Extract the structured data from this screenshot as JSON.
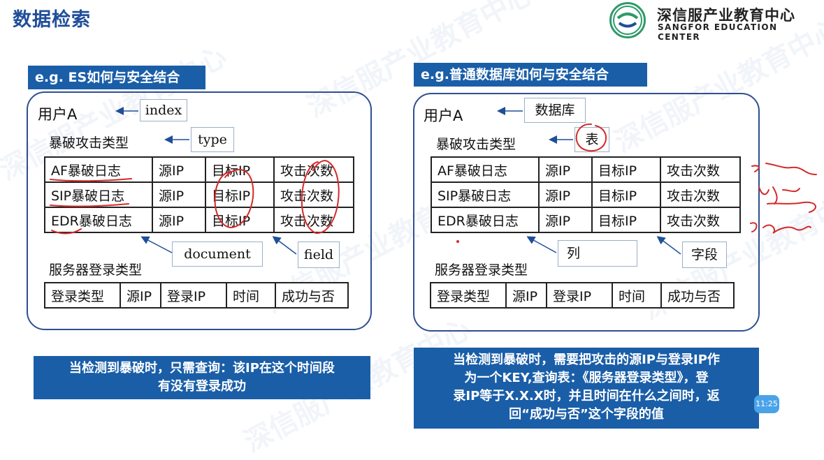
{
  "title": "数据检索",
  "logo": {
    "cn": "深信服产业教育中心",
    "en": "SANGFOR EDUCATION CENTER"
  },
  "watermark": "深信服产业教育中心",
  "left": {
    "banner": "e.g. ES如何与安全结合",
    "user": "用户A",
    "type_label": "暴破攻击类型",
    "tags": {
      "index": "index",
      "type": "type",
      "document": "document",
      "field": "field"
    },
    "table1": [
      [
        "AF暴破日志",
        "源IP",
        "目标IP",
        "攻击次数"
      ],
      [
        "SIP暴破日志",
        "源IP",
        "目标IP",
        "攻击次数"
      ],
      [
        "EDR暴破日志",
        "源IP",
        "目标IP",
        "攻击次数"
      ]
    ],
    "server_label": "服务器登录类型",
    "table2": [
      "登录类型",
      "源IP",
      "登录IP",
      "时间",
      "成功与否"
    ],
    "note": [
      "当检测到暴破时，只需查询：该IP在这个时间段",
      "有没有登录成功"
    ]
  },
  "right": {
    "banner": "e.g.普通数据库如何与安全结合",
    "user": "用户A",
    "type_label": "暴破攻击类型",
    "tags": {
      "db": "数据库",
      "table": "表",
      "column": "列",
      "field": "字段"
    },
    "table1": [
      [
        "AF暴破日志",
        "源IP",
        "目标IP",
        "攻击次数"
      ],
      [
        "SIP暴破日志",
        "源IP",
        "目标IP",
        "攻击次数"
      ],
      [
        "EDR暴破日志",
        "源IP",
        "目标IP",
        "攻击次数"
      ]
    ],
    "server_label": "服务器登录类型",
    "table2": [
      "登录类型",
      "源IP",
      "登录IP",
      "时间",
      "成功与否"
    ],
    "note": [
      "当检测到暴破时，需要把攻击的源IP与登录IP作",
      "为一个KEY,查询表：《服务器登录类型》，登",
      "录IP等于X.X.X时，并且时间在什么之间时，返",
      "回“成功与否”这个字段的值"
    ]
  },
  "time_badge": "11:25"
}
